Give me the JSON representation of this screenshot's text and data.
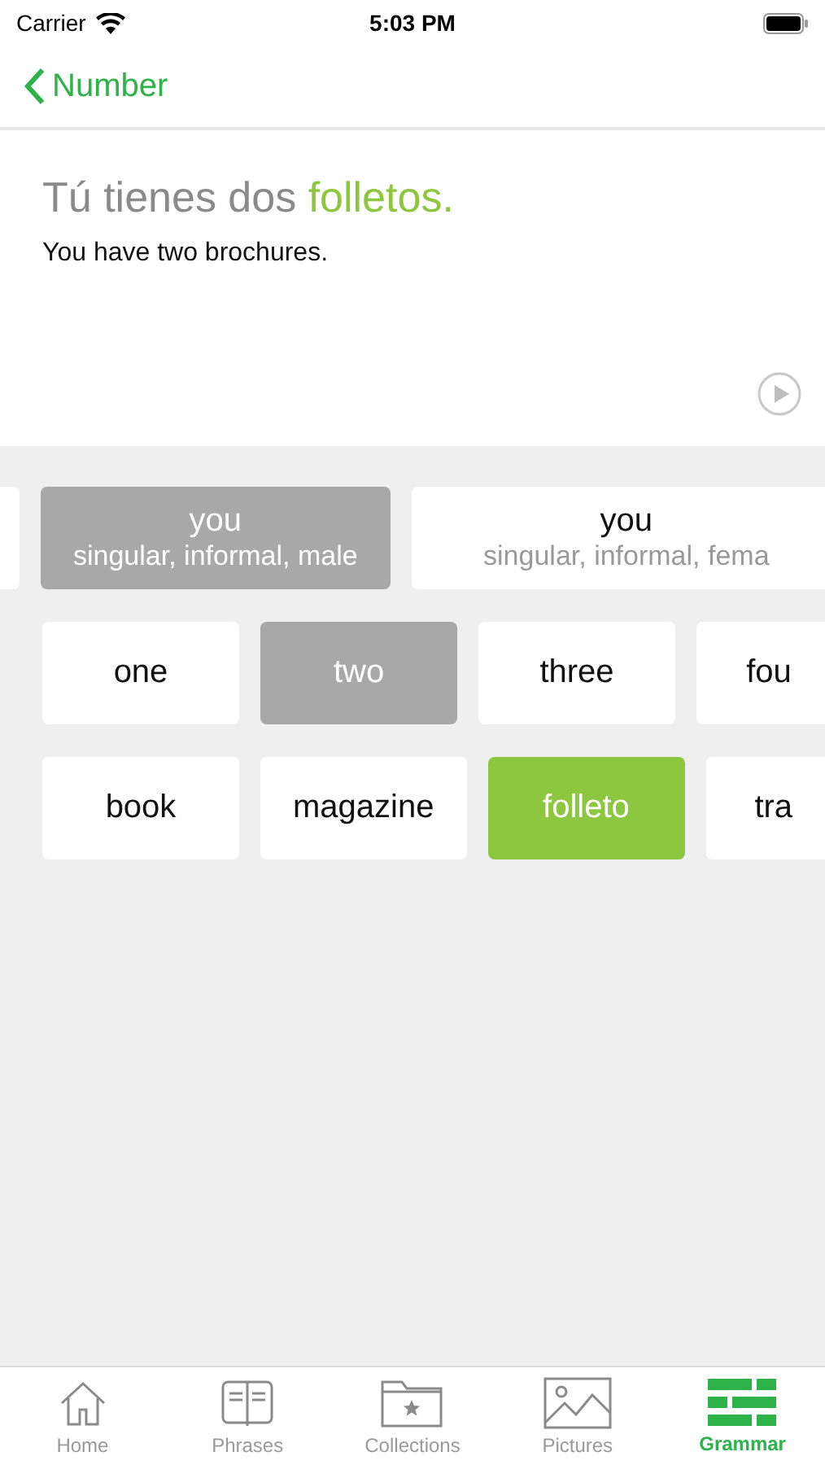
{
  "status_bar": {
    "carrier": "Carrier",
    "time": "5:03 PM"
  },
  "nav": {
    "back_label": "Number"
  },
  "sentence": {
    "parts": [
      {
        "text": "Tú tienes dos ",
        "highlight": false
      },
      {
        "text": "folletos.",
        "highlight": true
      }
    ],
    "translation": "You have two brochures."
  },
  "rows": [
    {
      "clipped_before": true,
      "tiles": [
        {
          "label": "you",
          "sub": "singular, informal, male",
          "selected": true,
          "cut": false
        },
        {
          "label": "you",
          "sub": "singular, informal, fema",
          "selected": false,
          "cut": true
        }
      ]
    },
    {
      "tiles": [
        {
          "label": "one",
          "selected": false,
          "cut": false
        },
        {
          "label": "two",
          "selected": true,
          "cut": false
        },
        {
          "label": "three",
          "selected": false,
          "cut": false
        },
        {
          "label": "fou",
          "selected": false,
          "cut": true
        }
      ]
    },
    {
      "tiles": [
        {
          "label": "book",
          "selected": false,
          "cut": false
        },
        {
          "label": "magazine",
          "selected": false,
          "cut": false
        },
        {
          "label": "folleto",
          "selected": true,
          "correct": true,
          "cut": false
        },
        {
          "label": "tra",
          "selected": false,
          "cut": true
        }
      ]
    }
  ],
  "tab_bar": [
    {
      "label": "Home",
      "kind": "home",
      "selected": false
    },
    {
      "label": "Phrases",
      "kind": "phrases",
      "selected": false
    },
    {
      "label": "Collections",
      "kind": "collections",
      "selected": false
    },
    {
      "label": "Pictures",
      "kind": "pictures",
      "selected": false
    },
    {
      "label": "Grammar",
      "kind": "grammar",
      "selected": true
    }
  ]
}
